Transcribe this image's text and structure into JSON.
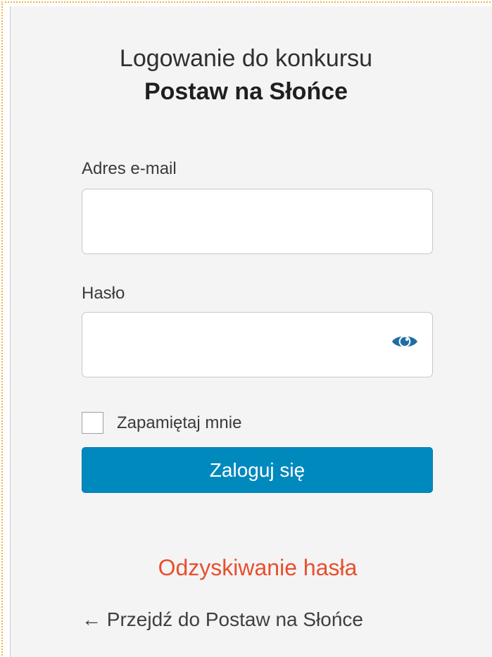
{
  "title": {
    "line1": "Logowanie do konkursu",
    "line2": "Postaw na Słońce"
  },
  "form": {
    "email_label": "Adres e-mail",
    "email_value": "",
    "password_label": "Hasło",
    "password_value": "",
    "remember_label": "Zapamiętaj mnie",
    "remember_checked": false,
    "submit_label": "Zaloguj się"
  },
  "links": {
    "recover_label": "Odzyskiwanie hasła",
    "back_label": "← Przejdź do Postaw na Słońce"
  },
  "icons": {
    "password_toggle": "eye-icon"
  },
  "colors": {
    "background": "#f4f4f4",
    "primary_button": "#0089bd",
    "recover_link": "#e84f2f",
    "text": "#3a3a3a"
  }
}
